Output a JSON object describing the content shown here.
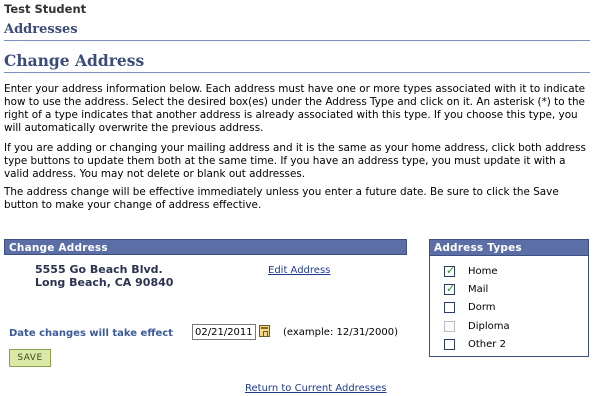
{
  "header": {
    "student_name": "Test Student",
    "section_title": "Addresses",
    "page_title": "Change Address"
  },
  "instructions": {
    "p1": "Enter your address information below.  Each address must have one or more types associated with it to indicate how to use the address.  Select the desired box(es) under the Address Type and click on it.  An asterisk (*) to the right of a type indicates that another address is already associated with this type.  If you choose this type, you will automatically overwrite the previous address.",
    "p2": "If you are adding or changing your mailing address and it is the same as your home address, click both address type buttons to update them both at the same time.  If you have an address type, you must update it with a valid address.  You may not delete or blank out addresses.",
    "p3": "The address change will be effective immediately unless you enter a future date.  Be sure to click the Save button to make your change of address effective."
  },
  "change_address": {
    "header": "Change Address",
    "address_line1": "5555 Go Beach Blvd.",
    "address_line2": "Long Beach, CA 90840",
    "edit_link": "Edit Address"
  },
  "address_types": {
    "header": "Address Types",
    "items": [
      {
        "label": "Home",
        "checked": true,
        "enabled": true
      },
      {
        "label": "Mail",
        "checked": true,
        "enabled": true
      },
      {
        "label": "Dorm",
        "checked": false,
        "enabled": true
      },
      {
        "label": "Diploma",
        "checked": false,
        "enabled": false
      },
      {
        "label": "Other 2",
        "checked": false,
        "enabled": true
      }
    ]
  },
  "effective_date": {
    "label": "Date changes will take effect",
    "value": "02/21/2011",
    "example": "(example: 12/31/2000)"
  },
  "actions": {
    "save_label": "SAVE",
    "return_link": "Return to Current Addresses"
  },
  "colors": {
    "header_bar": "#5b6fa6",
    "title_text": "#3b4b7a",
    "link": "#1f3a8f",
    "save_button": "#dbe9a8"
  }
}
